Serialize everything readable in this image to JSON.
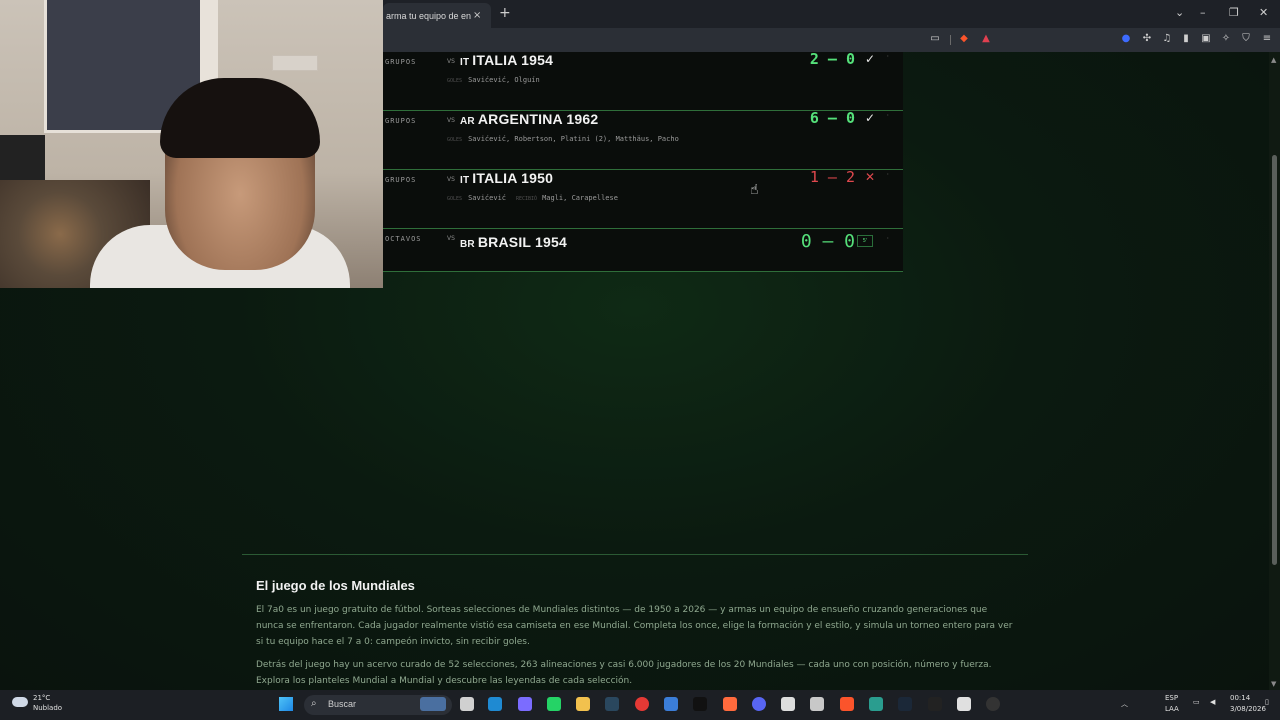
{
  "browser": {
    "tab_title": "arma tu equipo de ensu",
    "tab_close": "×",
    "new_tab": "+",
    "window_controls": [
      "⌄",
      "–",
      "❐",
      "✕"
    ]
  },
  "matches": [
    {
      "stage": "GRUPOS",
      "vs": "VS",
      "country_code": "IT",
      "opponent": "ITALIA 1954",
      "goals_label": "GOLES",
      "scorers": "Savićević, Olguín",
      "conceded_label": "",
      "conceded": "",
      "score": "2 – 0",
      "result": "win",
      "mark": "✓"
    },
    {
      "stage": "GRUPOS",
      "vs": "VS",
      "country_code": "AR",
      "opponent": "ARGENTINA 1962",
      "goals_label": "GOLES",
      "scorers": "Savićević, Robertson, Platini (2), Matthäus, Pacho",
      "conceded_label": "",
      "conceded": "",
      "score": "6 – 0",
      "result": "win",
      "mark": "✓"
    },
    {
      "stage": "GRUPOS",
      "vs": "VS",
      "country_code": "IT",
      "opponent": "ITALIA 1950",
      "goals_label": "GOLES",
      "scorers": "Savićević",
      "conceded_label": "RECIBIÓ",
      "conceded": "Magli, Carapellese",
      "score": "1 – 2",
      "result": "loss",
      "mark": "✕"
    },
    {
      "stage": "OCTAVOS",
      "vs": "VS",
      "country_code": "BR",
      "opponent": "BRASIL 1954",
      "goals_label": "",
      "scorers": "",
      "conceded_label": "",
      "conceded": "",
      "score": "0 – 0",
      "result": "draw",
      "mark": "",
      "penalty_badge": "5'"
    }
  ],
  "about": {
    "title": "El juego de los Mundiales",
    "p1": "El 7a0 es un juego gratuito de fútbol. Sorteas selecciones de Mundiales distintos — de 1950 a 2026 — y armas un equipo de ensueño cruzando generaciones que nunca se enfrentaron. Cada jugador realmente vistió esa camiseta en ese Mundial. Completa los once, elige la formación y el estilo, y simula un torneo entero para ver si tu equipo hace el 7 a 0: campeón invicto, sin recibir goles.",
    "p2": "Detrás del juego hay un acervo curado de 52 selecciones, 263 alineaciones y casi 6.000 jugadores de los 20 Mundiales — cada uno con posición, número y fuerza. Explora los planteles Mundial a Mundial y descubre las leyendas de cada selección."
  },
  "taskbar": {
    "weather_temp": "21°C",
    "weather_desc": "Nublado",
    "search_label": "Buscar",
    "lang_1": "ESP",
    "lang_2": "LAA",
    "time": "00:14",
    "date": "3/08/2026"
  },
  "colors": {
    "win": "#55e07a",
    "loss": "#e0484e",
    "accent_border": "#2f6e3a"
  }
}
